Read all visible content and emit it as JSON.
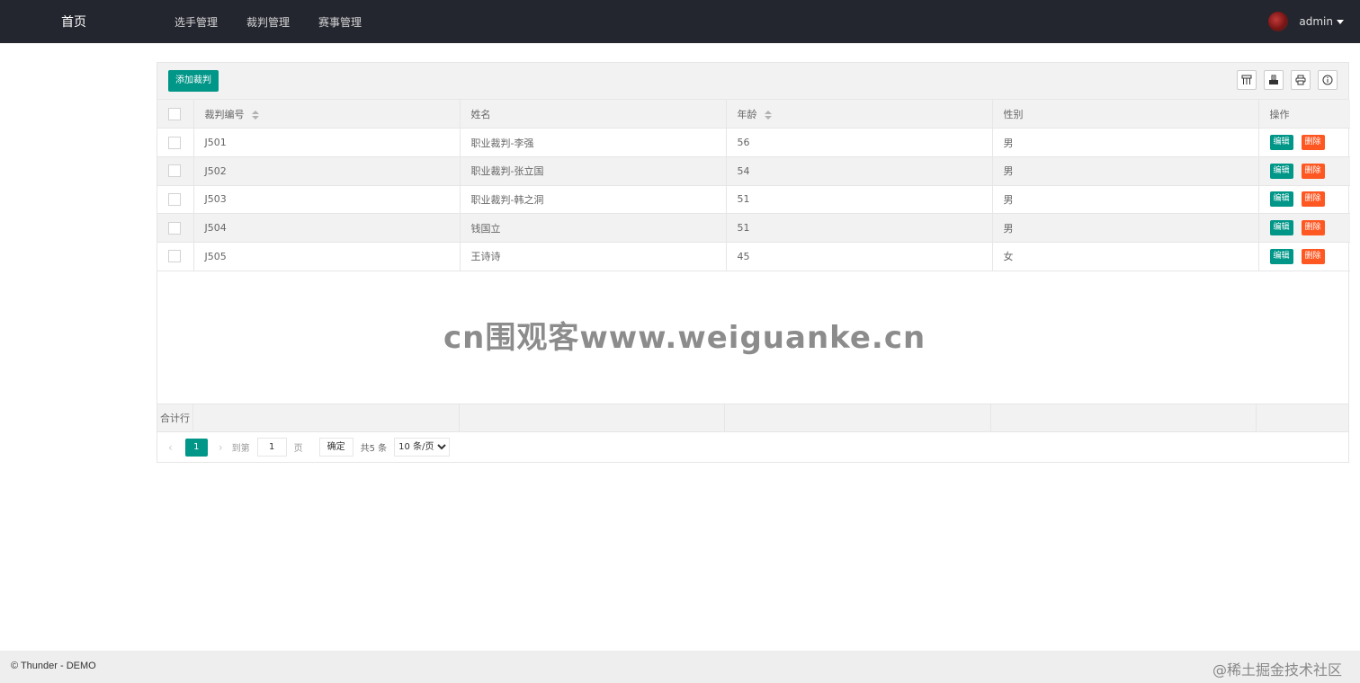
{
  "header": {
    "logo": "首页",
    "nav": [
      "选手管理",
      "裁判管理",
      "赛事管理"
    ],
    "user": "admin"
  },
  "toolbar": {
    "add_label": "添加裁判",
    "icons": [
      "columns-icon",
      "export-icon",
      "print-icon",
      "info-icon"
    ]
  },
  "table": {
    "columns": [
      "裁判编号",
      "姓名",
      "年龄",
      "性别",
      "操作"
    ],
    "rows": [
      {
        "id": "J501",
        "name": "职业裁判-李强",
        "age": "56",
        "sex": "男"
      },
      {
        "id": "J502",
        "name": "职业裁判-张立国",
        "age": "54",
        "sex": "男"
      },
      {
        "id": "J503",
        "name": "职业裁判-韩之洞",
        "age": "51",
        "sex": "男"
      },
      {
        "id": "J504",
        "name": "钱国立",
        "age": "51",
        "sex": "男"
      },
      {
        "id": "J505",
        "name": "王诗诗",
        "age": "45",
        "sex": "女"
      }
    ],
    "edit_label": "编辑",
    "delete_label": "删除",
    "total_label": "合计行"
  },
  "watermark": "cn围观客www.weiguanke.cn",
  "pager": {
    "current": "1",
    "goto_label": "到第",
    "page_input": "1",
    "page_unit": "页",
    "confirm_label": "确定",
    "total_text": "共5 条",
    "page_size": "10 条/页"
  },
  "footer": {
    "copyright": "© Thunder - DEMO",
    "credit": "@稀土掘金技术社区"
  },
  "colors": {
    "header_bg": "#23262e",
    "primary": "#009688",
    "danger": "#ff5722"
  }
}
